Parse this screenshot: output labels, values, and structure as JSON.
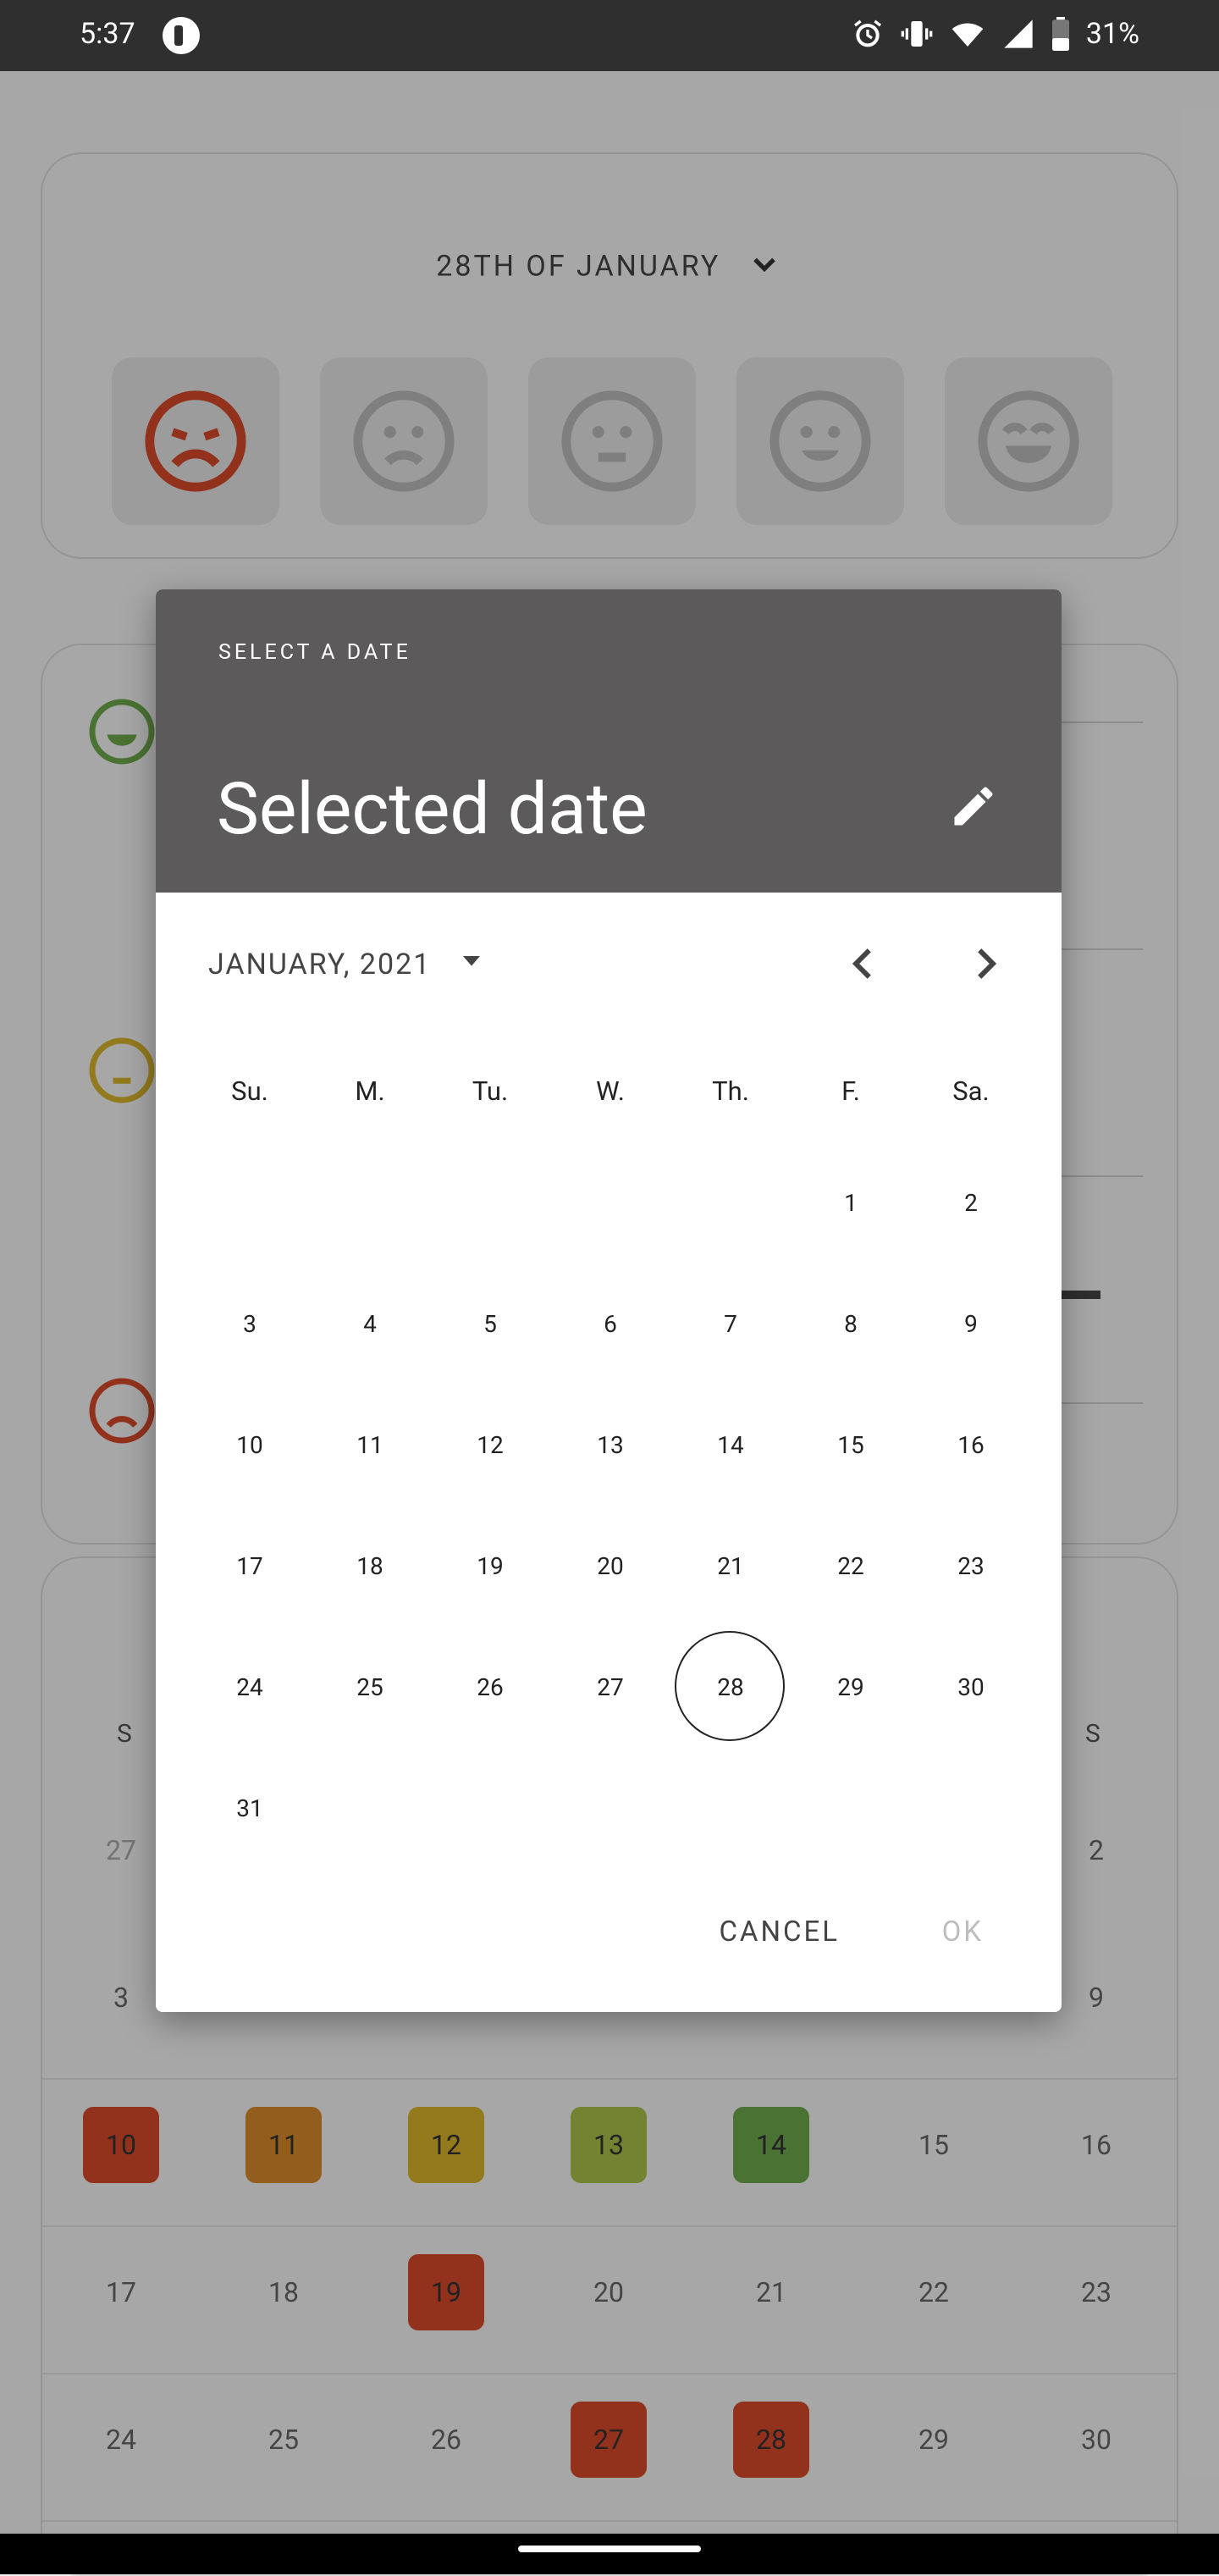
{
  "status_bar": {
    "time": "5:37",
    "battery": "31%",
    "icons": [
      "alarm-icon",
      "vibrate-icon",
      "wifi-icon",
      "signal-icon",
      "battery-icon"
    ]
  },
  "background": {
    "date_selector": "28TH OF JANUARY",
    "mood_options": [
      "very-sad",
      "sad",
      "neutral",
      "happy",
      "very-happy"
    ],
    "calendar": {
      "headers": [
        "S",
        "S"
      ],
      "rows": [
        [
          "27",
          "",
          "",
          "",
          "",
          "",
          "2"
        ],
        [
          "3",
          "",
          "",
          "",
          "",
          "",
          "9"
        ],
        [
          "10",
          "11",
          "12",
          "13",
          "14",
          "15",
          "16"
        ],
        [
          "17",
          "18",
          "19",
          "20",
          "21",
          "22",
          "23"
        ],
        [
          "24",
          "25",
          "26",
          "27",
          "28",
          "29",
          "30"
        ]
      ]
    },
    "colors": {
      "very_sad": "#d84a2b",
      "sad": "#d98a2b",
      "neutral": "#d9b42b",
      "happy": "#a8c24a",
      "very_happy": "#6ea84a"
    }
  },
  "dialog": {
    "eyebrow": "SELECT A DATE",
    "title": "Selected date",
    "month_label": "JANUARY, 2021",
    "weekdays": [
      "Su.",
      "M.",
      "Tu.",
      "W.",
      "Th.",
      "F.",
      "Sa."
    ],
    "weeks": [
      [
        "",
        "",
        "",
        "",
        "",
        "1",
        "2"
      ],
      [
        "3",
        "4",
        "5",
        "6",
        "7",
        "8",
        "9"
      ],
      [
        "10",
        "11",
        "12",
        "13",
        "14",
        "15",
        "16"
      ],
      [
        "17",
        "18",
        "19",
        "20",
        "21",
        "22",
        "23"
      ],
      [
        "24",
        "25",
        "26",
        "27",
        "28",
        "29",
        "30"
      ],
      [
        "31",
        "",
        "",
        "",
        "",
        "",
        ""
      ]
    ],
    "selected_day": "28",
    "cancel_label": "CANCEL",
    "ok_label": "OK",
    "header_color": "#5c5a5b"
  }
}
